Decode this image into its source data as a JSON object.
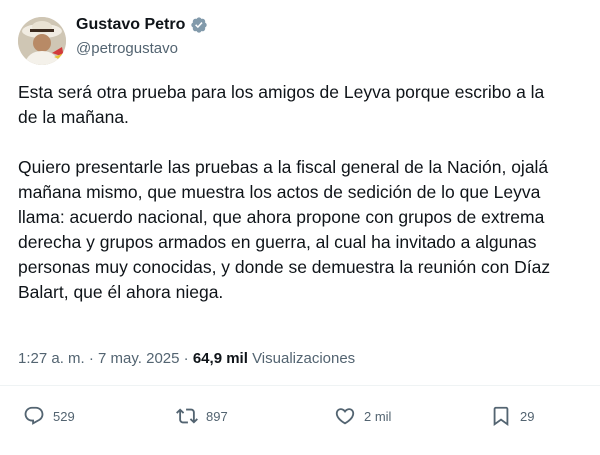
{
  "author": {
    "display_name": "Gustavo Petro",
    "handle": "@petrogustavo",
    "verified_color": "#829aab"
  },
  "tweet": {
    "paragraph1": [
      "Esta será otra prueba para los amigos de Leyva porque escribo a la",
      "de la mañana."
    ],
    "paragraph2": [
      "Quiero presentarle las pruebas a la fiscal general de la Nación, ojalá",
      "mañana mismo, que muestra los actos de sedición de lo que Leyva",
      "llama: acuerdo nacional, que ahora propone con grupos de extrema",
      "derecha y grupos armados en guerra, al cual ha invitado a algunas",
      "personas muy conocidas, y donde se demuestra la reunión con Díaz",
      "Balart, que él ahora niega."
    ]
  },
  "meta": {
    "time": "1:27 a. m.",
    "separator": "·",
    "date": "7 may. 2025",
    "views_count": "64,9 mil",
    "views_label": "Visualizaciones"
  },
  "actions": {
    "replies": "529",
    "reposts": "897",
    "likes": "2 mil",
    "bookmarks": "29"
  },
  "colors": {
    "text_primary": "#0f1419",
    "text_secondary": "#536471",
    "divider": "#eff3f4"
  }
}
